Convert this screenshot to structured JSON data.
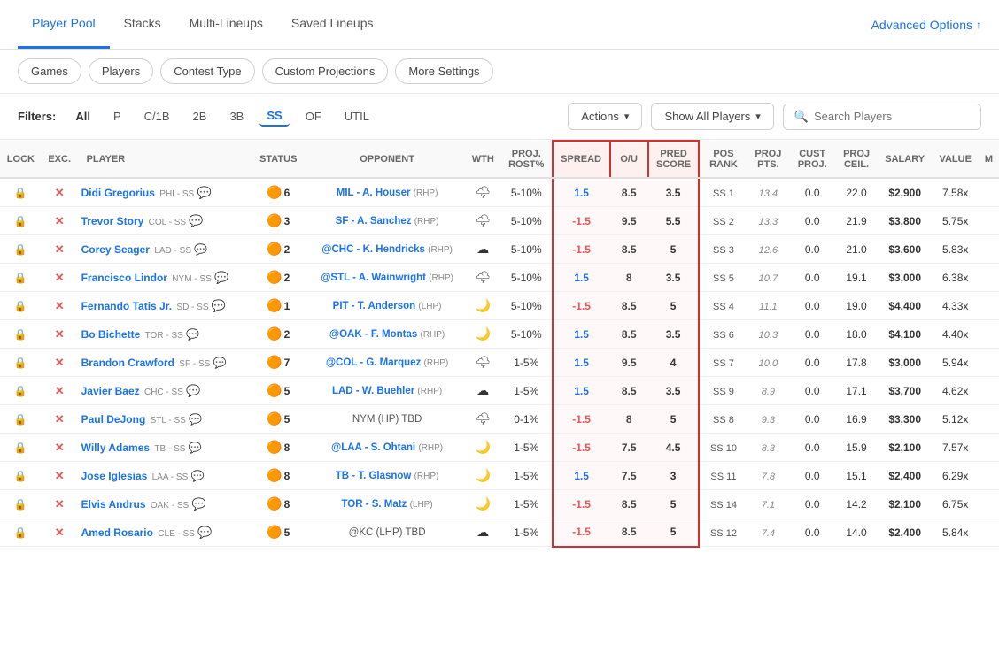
{
  "nav": {
    "tabs": [
      {
        "label": "Player Pool",
        "active": true
      },
      {
        "label": "Stacks",
        "active": false
      },
      {
        "label": "Multi-Lineups",
        "active": false
      },
      {
        "label": "Saved Lineups",
        "active": false
      }
    ],
    "advanced_options": "Advanced Options"
  },
  "filter_bar": {
    "buttons": [
      "Games",
      "Players",
      "Contest Type",
      "Custom Projections",
      "More Settings"
    ]
  },
  "table_controls": {
    "filters_label": "Filters:",
    "filter_tags": [
      "All",
      "P",
      "C/1B",
      "2B",
      "3B",
      "SS",
      "OF",
      "UTIL"
    ],
    "active_filter": "SS",
    "actions_label": "Actions",
    "show_players_label": "Show All Players",
    "search_placeholder": "Search Players"
  },
  "table": {
    "headers": [
      "LOCK",
      "EXC.",
      "PLAYER",
      "STATUS",
      "OPPONENT",
      "WTH",
      "PROJ. ROST%",
      "SPREAD",
      "O/U",
      "PRED SCORE",
      "POS RANK",
      "PROJ PTS.",
      "CUST PROJ.",
      "PROJ CEIL.",
      "SALARY",
      "VALUE",
      "M"
    ],
    "rows": [
      {
        "lock": "🔒",
        "exc": "✕",
        "player": "Didi Gregorius",
        "team": "PHI - SS",
        "msg": true,
        "status_dot": "🟠",
        "status_val": "6",
        "opponent": "MIL - A. Houser",
        "opp_type": "RHP",
        "weather": "🌩",
        "proj": "5-10%",
        "spread": "1.5",
        "spread_pos": true,
        "ou": "8.5",
        "pred": "3.5",
        "pos_rank": "SS 1",
        "proj_pts": "13.4",
        "cust": "0.0",
        "ceil": "22.0",
        "salary": "$2,900",
        "value": "7.58x"
      },
      {
        "lock": "🔒",
        "exc": "✕",
        "player": "Trevor Story",
        "team": "COL - SS",
        "msg": true,
        "status_dot": "🟠",
        "status_val": "3",
        "opponent": "SF - A. Sanchez",
        "opp_type": "RHP",
        "weather": "🌩",
        "proj": "5-10%",
        "spread": "-1.5",
        "spread_pos": false,
        "ou": "9.5",
        "pred": "5.5",
        "pos_rank": "SS 2",
        "proj_pts": "13.3",
        "cust": "0.0",
        "ceil": "21.9",
        "salary": "$3,800",
        "value": "5.75x"
      },
      {
        "lock": "🔒",
        "exc": "✕",
        "player": "Corey Seager",
        "team": "LAD - SS",
        "msg": false,
        "status_dot": "🟠",
        "status_val": "2",
        "opponent": "@CHC - K. Hendricks",
        "opp_type": "RHP",
        "weather": "☁",
        "proj": "5-10%",
        "spread": "-1.5",
        "spread_pos": false,
        "ou": "8.5",
        "pred": "5",
        "pos_rank": "SS 3",
        "proj_pts": "12.6",
        "cust": "0.0",
        "ceil": "21.0",
        "salary": "$3,600",
        "value": "5.83x"
      },
      {
        "lock": "🔒",
        "exc": "✕",
        "player": "Francisco Lindor",
        "team": "NYM - SS",
        "msg": true,
        "status_dot": "🟠",
        "status_val": "2",
        "opponent": "@STL - A. Wainwright",
        "opp_type": "RHP",
        "weather": "🌩",
        "proj": "5-10%",
        "spread": "1.5",
        "spread_pos": true,
        "ou": "8",
        "pred": "3.5",
        "pos_rank": "SS 5",
        "proj_pts": "10.7",
        "cust": "0.0",
        "ceil": "19.1",
        "salary": "$3,000",
        "value": "6.38x"
      },
      {
        "lock": "🔒",
        "exc": "✕",
        "player": "Fernando Tatis Jr.",
        "team": "SD - SS",
        "msg": true,
        "status_dot": "🟠",
        "status_val": "1",
        "opponent": "PIT - T. Anderson",
        "opp_type": "LHP",
        "weather": "🌙",
        "proj": "5-10%",
        "spread": "-1.5",
        "spread_pos": false,
        "ou": "8.5",
        "pred": "5",
        "pos_rank": "SS 4",
        "proj_pts": "11.1",
        "cust": "0.0",
        "ceil": "19.0",
        "salary": "$4,400",
        "value": "4.33x"
      },
      {
        "lock": "🔒",
        "exc": "✕",
        "player": "Bo Bichette",
        "team": "TOR - SS",
        "msg": false,
        "status_dot": "🟠",
        "status_val": "2",
        "opponent": "@OAK - F. Montas",
        "opp_type": "RHP",
        "weather": "🌙",
        "proj": "5-10%",
        "spread": "1.5",
        "spread_pos": true,
        "ou": "8.5",
        "pred": "3.5",
        "pos_rank": "SS 6",
        "proj_pts": "10.3",
        "cust": "0.0",
        "ceil": "18.0",
        "salary": "$4,100",
        "value": "4.40x"
      },
      {
        "lock": "🔒",
        "exc": "✕",
        "player": "Brandon Crawford",
        "team": "SF - SS",
        "msg": false,
        "status_dot": "🟠",
        "status_val": "7",
        "opponent": "@COL - G. Marquez",
        "opp_type": "RHP",
        "weather": "🌩",
        "proj": "1-5%",
        "spread": "1.5",
        "spread_pos": true,
        "ou": "9.5",
        "pred": "4",
        "pos_rank": "SS 7",
        "proj_pts": "10.0",
        "cust": "0.0",
        "ceil": "17.8",
        "salary": "$3,000",
        "value": "5.94x"
      },
      {
        "lock": "🔒",
        "exc": "✕",
        "player": "Javier Baez",
        "team": "CHC - SS",
        "msg": true,
        "status_dot": "🟠",
        "status_val": "5",
        "opponent": "LAD - W. Buehler",
        "opp_type": "RHP",
        "weather": "☁",
        "proj": "1-5%",
        "spread": "1.5",
        "spread_pos": true,
        "ou": "8.5",
        "pred": "3.5",
        "pos_rank": "SS 9",
        "proj_pts": "8.9",
        "cust": "0.0",
        "ceil": "17.1",
        "salary": "$3,700",
        "value": "4.62x"
      },
      {
        "lock": "🔒",
        "exc": "✕",
        "player": "Paul DeJong",
        "team": "STL - SS",
        "msg": false,
        "status_dot": "🟠",
        "status_val": "5",
        "opponent": "NYM (HP) TBD",
        "opp_type": "",
        "weather": "🌩",
        "proj": "0-1%",
        "spread": "-1.5",
        "spread_pos": false,
        "ou": "8",
        "pred": "5",
        "pos_rank": "SS 8",
        "proj_pts": "9.3",
        "cust": "0.0",
        "ceil": "16.9",
        "salary": "$3,300",
        "value": "5.12x"
      },
      {
        "lock": "🔒",
        "exc": "✕",
        "player": "Willy Adames",
        "team": "TB - SS",
        "msg": false,
        "status_dot": "🟠",
        "status_val": "8",
        "opponent": "@LAA - S. Ohtani",
        "opp_type": "RHP",
        "weather": "🌙",
        "proj": "1-5%",
        "spread": "-1.5",
        "spread_pos": false,
        "ou": "7.5",
        "pred": "4.5",
        "pos_rank": "SS 10",
        "proj_pts": "8.3",
        "cust": "0.0",
        "ceil": "15.9",
        "salary": "$2,100",
        "value": "7.57x"
      },
      {
        "lock": "🔒",
        "exc": "✕",
        "player": "Jose Iglesias",
        "team": "LAA - SS",
        "msg": false,
        "status_dot": "🟠",
        "status_val": "8",
        "opponent": "TB - T. Glasnow",
        "opp_type": "RHP",
        "weather": "🌙",
        "proj": "1-5%",
        "spread": "1.5",
        "spread_pos": true,
        "ou": "7.5",
        "pred": "3",
        "pos_rank": "SS 11",
        "proj_pts": "7.8",
        "cust": "0.0",
        "ceil": "15.1",
        "salary": "$2,400",
        "value": "6.29x"
      },
      {
        "lock": "🔒",
        "exc": "✕",
        "player": "Elvis Andrus",
        "team": "OAK - SS",
        "msg": true,
        "status_dot": "🟠",
        "status_val": "8",
        "opponent": "TOR - S. Matz",
        "opp_type": "LHP",
        "weather": "🌙",
        "proj": "1-5%",
        "spread": "-1.5",
        "spread_pos": false,
        "ou": "8.5",
        "pred": "5",
        "pos_rank": "SS 14",
        "proj_pts": "7.1",
        "cust": "0.0",
        "ceil": "14.2",
        "salary": "$2,100",
        "value": "6.75x"
      },
      {
        "lock": "🔒",
        "exc": "✕",
        "player": "Amed Rosario",
        "team": "CLE - SS",
        "msg": true,
        "status_dot": "🟠",
        "status_val": "5",
        "opponent": "@KC (LHP) TBD",
        "opp_type": "",
        "weather": "☁",
        "proj": "1-5%",
        "spread": "-1.5",
        "spread_pos": false,
        "ou": "8.5",
        "pred": "5",
        "pos_rank": "SS 12",
        "proj_pts": "7.4",
        "cust": "0.0",
        "ceil": "14.0",
        "salary": "$2,400",
        "value": "5.84x"
      }
    ]
  }
}
